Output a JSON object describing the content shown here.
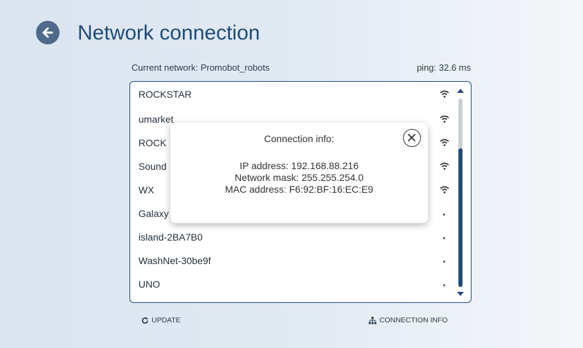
{
  "header": {
    "title": "Network connection"
  },
  "status": {
    "current_network": "Current network: Promobot_robots",
    "ping": "ping: 32.6 ms"
  },
  "networks": [
    {
      "name": "ROCKSTAR",
      "signal": "wifi-icon"
    },
    {
      "name": "umarket",
      "signal": "wifi-icon"
    },
    {
      "name": "ROCK",
      "signal": "wifi-icon"
    },
    {
      "name": "Sound",
      "signal": "wifi-icon"
    },
    {
      "name": "WX",
      "signal": "wifi-icon"
    },
    {
      "name": "Galaxy",
      "signal": "dot"
    },
    {
      "name": "island-2BA7B0",
      "signal": "dot"
    },
    {
      "name": "WashNet-30be9f",
      "signal": "dot"
    },
    {
      "name": "UNO",
      "signal": "dot"
    }
  ],
  "modal": {
    "title": "Connection info:",
    "ip": "IP address: 192.168.88.216",
    "mask": "Network mask: 255.255.254.0",
    "mac": "MAC address: F6:92:BF:16:EC:E9"
  },
  "footer": {
    "update_label": "UPDATE",
    "connection_info_label": "CONNECTION INFO"
  },
  "colors": {
    "accent": "#1f4b78",
    "back_button": "#4f6a8a"
  }
}
